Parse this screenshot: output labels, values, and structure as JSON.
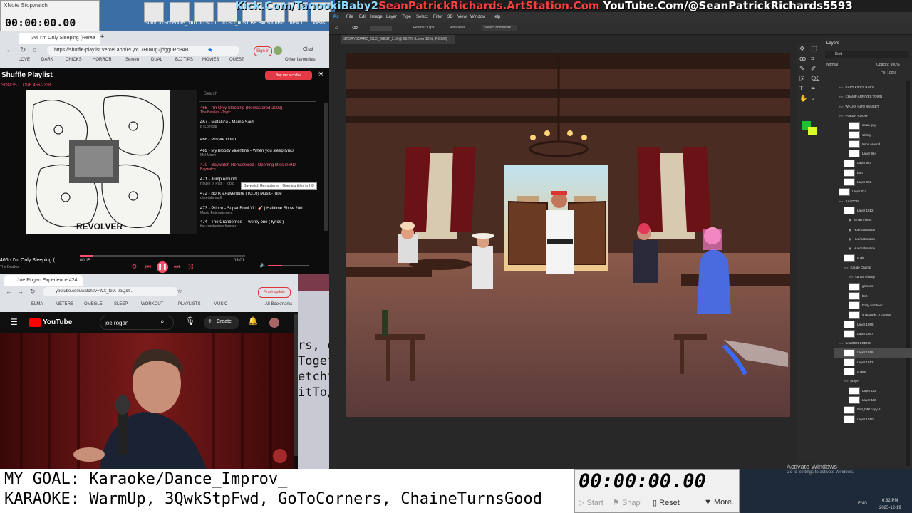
{
  "desktop": {
    "stopwatch_title": "XNote Stopwatch",
    "stopwatch_value": "00:00:00.00",
    "icons": [
      "Sumo ld",
      "reasons_to_...",
      "Schedule_.txt",
      "JIU JITSU...",
      "JIU JITSU_MY ...",
      "JUST BE HONEST",
      "sdfsdf.dfsd...",
      "new 1",
      "ideas"
    ]
  },
  "banner": {
    "part1": "Kick.Com/TanookiBaby2",
    "part2": "SeanPatrickRichards.ArtStation.Com",
    "part3": "YouTube.Com/@SeanPatrickRichards5593"
  },
  "chrome1": {
    "tab_label": "3% I'm Only Sleeping (Rema",
    "url": "https://shuffle-playlist.vercel.app/PLyYJ7Huxug2jdgg0RcPAB...",
    "sign_in": "Sign in",
    "chat": "Chat",
    "bookmarks": [
      "LOVE",
      "DARK",
      "CHICKS",
      "HORROR",
      "Semen",
      "DUAL",
      "BJJ TIPS",
      "MOVIES",
      "QUEST"
    ],
    "other_favourites": "Other favourites"
  },
  "playlist": {
    "title": "Shuffle Playlist",
    "subtitle": "SONGS I LOVE   466/2238",
    "coffee": "Buy me a coffee",
    "search_placeholder": "Search",
    "album_text": "REVOLVER",
    "tracks": [
      {
        "name": "466 - I'm Only Sleeping (Remastered 2009)",
        "artist": "The Beatles - Topic",
        "active": true
      },
      {
        "name": "467 - Metallica - Mama Said",
        "artist": "BTLofficial",
        "active": false
      },
      {
        "name": "468 - Private video",
        "artist": "",
        "active": false
      },
      {
        "name": "469 - My bloody valentine - When you sleep lyrics",
        "artist": "Mel Moon",
        "active": false
      },
      {
        "name": "470 - Baywatch Remastered | Opening titles in HD",
        "artist": "Baywatch",
        "active": true
      },
      {
        "name": "471 - Jump Around",
        "artist": "House of Pain - Topic",
        "active": false
      },
      {
        "name": "472 - Bonk's Adventure (TG16) Music- Title",
        "artist": "cheetahmanfl",
        "active": false
      },
      {
        "name": "473 - Prince - Super Bowl XLI 🎸 | Halftime Show 200...",
        "artist": "Music Entertainment",
        "active": false
      },
      {
        "name": "474 - The Cranberries - Twenty one ( lyrics )",
        "artist": "the cranberries forever",
        "active": false
      }
    ],
    "tooltip": "Baywatch Remastered | Opening titles in HD",
    "now_playing": "466 - I'm Only Sleeping (...",
    "now_artist": "The Beatles",
    "time_current": "00:15",
    "time_total": "03:01",
    "progress_fraction": 0.08,
    "volume_fraction": 0.35
  },
  "chrome2": {
    "tab_label": "Joe Rogan Experience #24...",
    "url": "youtube.com/watch?v=WX_teiX-0aQ&t...",
    "finish_update": "Finish update",
    "bookmarks": [
      "ELMA",
      "METERS",
      "OMEGLE",
      "SLEEP",
      "WORKOUT",
      "PLAYLISTS",
      "MUSIC"
    ],
    "all_bookmarks": "All Bookmarks"
  },
  "youtube": {
    "logo": "YouTube",
    "search_value": "joe rogan",
    "create": "Create"
  },
  "middle_text": [
    "rs, c",
    "Toget",
    "etchi",
    "itTo/"
  ],
  "photoshop": {
    "menu": [
      "File",
      "Edit",
      "Image",
      "Layer",
      "Type",
      "Select",
      "Filter",
      "3D",
      "View",
      "Window",
      "Help"
    ],
    "feather": "Feather: 0 px",
    "anti_alias": "Anti-alias",
    "select_mask": "Select and Mask...",
    "doc_tab": "STORYBOARD_OLD_WEST_2.tif @ 66.7% (Layer 1016, RGB/8)",
    "layers_tab": "Layers",
    "kind": "Kind",
    "blend_mode": "Normal",
    "opacity": "Opacity: 100%",
    "fill": "Fill: 100%",
    "layers": [
      {
        "name": "BART KICKS BABY",
        "indent": 1,
        "type": "group"
      },
      {
        "name": "CHAMP ARRIVES TOWN",
        "indent": 1,
        "type": "group"
      },
      {
        "name": "WALKS INTO SUNSET",
        "indent": 1,
        "type": "group"
      },
      {
        "name": "POKER ROOM",
        "indent": 1,
        "type": "group"
      },
      {
        "name": "asian guy",
        "indent": 3,
        "type": "layer"
      },
      {
        "name": "sitting",
        "indent": 3,
        "type": "layer"
      },
      {
        "name": "turns around",
        "indent": 3,
        "type": "layer"
      },
      {
        "name": "Layer 964",
        "indent": 3,
        "type": "layer"
      },
      {
        "name": "Layer 987",
        "indent": 2,
        "type": "layer"
      },
      {
        "name": "bart",
        "indent": 2,
        "type": "layer"
      },
      {
        "name": "Layer 962",
        "indent": 2,
        "type": "layer"
      },
      {
        "name": "Layer 824",
        "indent": 1,
        "type": "layer"
      },
      {
        "name": "SALOON",
        "indent": 1,
        "type": "group"
      },
      {
        "name": "Layer 1012",
        "indent": 2,
        "type": "layer"
      },
      {
        "name": "Smart Filters",
        "indent": 3,
        "type": "fx"
      },
      {
        "name": "Hue/Saturation",
        "indent": 3,
        "type": "fx"
      },
      {
        "name": "Hue/Saturation",
        "indent": 3,
        "type": "fx"
      },
      {
        "name": "Hue/Saturation",
        "indent": 3,
        "type": "fx"
      },
      {
        "name": "chair",
        "indent": 2,
        "type": "layer"
      },
      {
        "name": "Karate Champ",
        "indent": 2,
        "type": "group"
      },
      {
        "name": "karate champ",
        "indent": 3,
        "type": "group"
      },
      {
        "name": "glasses",
        "indent": 3,
        "type": "layer"
      },
      {
        "name": "belt",
        "indent": 3,
        "type": "layer"
      },
      {
        "name": "body and head",
        "indent": 3,
        "type": "layer"
      },
      {
        "name": "shadow k...e champ",
        "indent": 3,
        "type": "layer"
      },
      {
        "name": "Layer 1058",
        "indent": 2,
        "type": "layer"
      },
      {
        "name": "Layer 1057",
        "indent": 2,
        "type": "layer"
      },
      {
        "name": "SALOON SCENE",
        "indent": 1,
        "type": "group"
      },
      {
        "name": "Layer 1016",
        "indent": 2,
        "type": "layer"
      },
      {
        "name": "Layer 1012",
        "indent": 2,
        "type": "layer"
      },
      {
        "name": "chairs",
        "indent": 2,
        "type": "layer"
      },
      {
        "name": "prayer",
        "indent": 2,
        "type": "group"
      },
      {
        "name": "Layer 114",
        "indent": 3,
        "type": "layer"
      },
      {
        "name": "Layer 113",
        "indent": 3,
        "type": "layer"
      },
      {
        "name": "bart_DRI copy 2",
        "indent": 2,
        "type": "layer"
      },
      {
        "name": "Layer 1010",
        "indent": 2,
        "type": "layer"
      }
    ]
  },
  "windows": {
    "activate_title": "Activate Windows",
    "activate_sub": "Go to Settings to activate Windows.",
    "time": "6:32 PM",
    "date": "2025-12-19",
    "lang": "ENG"
  },
  "overlay": {
    "goal": "MY GOAL: Karaoke/Dance_Improv_",
    "karaoke": "KARAOKE: WarmUp, 3QwkStpFwd, GoToCorners, ChaineTurnsGood"
  },
  "stopwatch": {
    "time": "00:00:00.00",
    "start": "Start",
    "snap": "Snap",
    "reset": "Reset",
    "more": "More..."
  }
}
